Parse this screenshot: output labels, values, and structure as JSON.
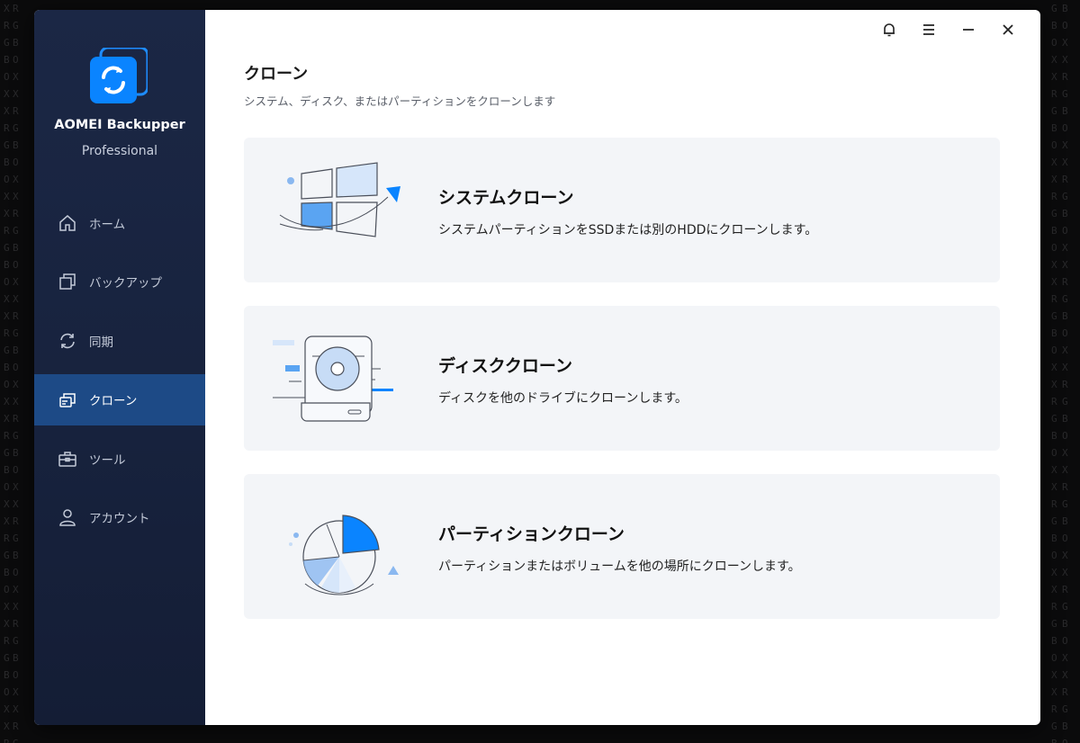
{
  "app": {
    "name": "AOMEI Backupper",
    "edition": "Professional"
  },
  "sidebar": {
    "items": [
      {
        "label": "ホーム",
        "icon": "home-icon"
      },
      {
        "label": "バックアップ",
        "icon": "backup-icon"
      },
      {
        "label": "同期",
        "icon": "sync-icon"
      },
      {
        "label": "クローン",
        "icon": "clone-icon",
        "active": true
      },
      {
        "label": "ツール",
        "icon": "toolbox-icon"
      },
      {
        "label": "アカウント",
        "icon": "user-icon"
      }
    ]
  },
  "titlebar": {
    "icons": [
      "bell-icon",
      "menu-icon",
      "minimize-icon",
      "close-icon"
    ]
  },
  "main": {
    "title": "クローン",
    "subtitle": "システム、ディスク、またはパーティションをクローンします",
    "cards": [
      {
        "title": "システムクローン",
        "description": "システムパーティションをSSDまたは別のHDDにクローンします。",
        "icon": "windows-illustration"
      },
      {
        "title": "ディスククローン",
        "description": "ディスクを他のドライブにクローンします。",
        "icon": "disk-illustration"
      },
      {
        "title": "パーティションクローン",
        "description": "パーティションまたはボリュームを他の場所にクローンします。",
        "icon": "partition-pie-illustration"
      }
    ]
  },
  "colors": {
    "sidebar_bg": "#1b2745",
    "active_nav": "#1d4a86",
    "accent": "#0a84ff",
    "card_bg": "#f3f5f8"
  }
}
